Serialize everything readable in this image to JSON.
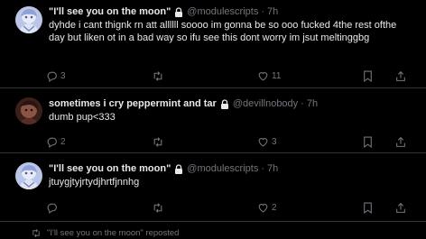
{
  "posts": [
    {
      "display_name": "\"I'll see you on the moon\"",
      "handle": "@modulescripts",
      "time": "7h",
      "text": "dyhde i cant thignk rn att allllll soooo im gonna be so ooo fucked 4the rest ofthe day but liken ot in a bad way so ifu see this dont worry im jsut meltinggbg",
      "replies": "3",
      "retweets": "",
      "likes": "11",
      "avatar_icon": "anime-avatar-icon"
    },
    {
      "display_name": "sometimes i cry peppermint and tar",
      "handle": "@devillnobody",
      "time": "7h",
      "text": "dumb pup<333",
      "replies": "2",
      "retweets": "",
      "likes": "3",
      "avatar_icon": "dark-avatar-icon"
    },
    {
      "display_name": "\"I'll see you on the moon\"",
      "handle": "@modulescripts",
      "time": "7h",
      "text": "jtuygjtyjrtydjhrtfjnnhg",
      "replies": "",
      "retweets": "",
      "likes": "2",
      "avatar_icon": "anime-avatar-icon"
    }
  ],
  "repost_footer": {
    "text": "\"I'll see you on the moon\" reposted"
  },
  "colors": {
    "background": "#000000",
    "text_primary": "#e7e9ea",
    "text_secondary": "#71767b",
    "divider": "#2f3336"
  },
  "separator": "·"
}
